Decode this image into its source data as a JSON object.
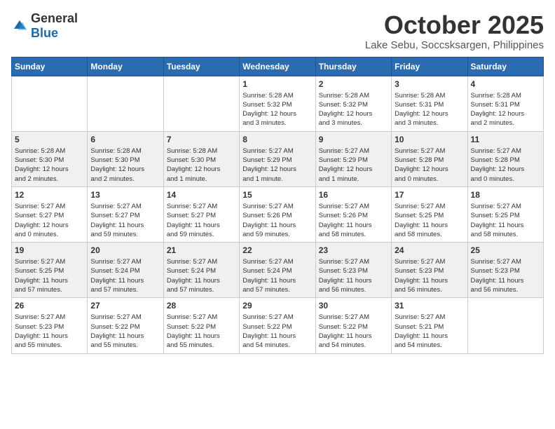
{
  "logo": {
    "general": "General",
    "blue": "Blue"
  },
  "title": "October 2025",
  "location": "Lake Sebu, Soccsksargen, Philippines",
  "weekdays": [
    "Sunday",
    "Monday",
    "Tuesday",
    "Wednesday",
    "Thursday",
    "Friday",
    "Saturday"
  ],
  "weeks": [
    [
      {
        "day": "",
        "info": ""
      },
      {
        "day": "",
        "info": ""
      },
      {
        "day": "",
        "info": ""
      },
      {
        "day": "1",
        "info": "Sunrise: 5:28 AM\nSunset: 5:32 PM\nDaylight: 12 hours\nand 3 minutes."
      },
      {
        "day": "2",
        "info": "Sunrise: 5:28 AM\nSunset: 5:32 PM\nDaylight: 12 hours\nand 3 minutes."
      },
      {
        "day": "3",
        "info": "Sunrise: 5:28 AM\nSunset: 5:31 PM\nDaylight: 12 hours\nand 3 minutes."
      },
      {
        "day": "4",
        "info": "Sunrise: 5:28 AM\nSunset: 5:31 PM\nDaylight: 12 hours\nand 2 minutes."
      }
    ],
    [
      {
        "day": "5",
        "info": "Sunrise: 5:28 AM\nSunset: 5:30 PM\nDaylight: 12 hours\nand 2 minutes."
      },
      {
        "day": "6",
        "info": "Sunrise: 5:28 AM\nSunset: 5:30 PM\nDaylight: 12 hours\nand 2 minutes."
      },
      {
        "day": "7",
        "info": "Sunrise: 5:28 AM\nSunset: 5:30 PM\nDaylight: 12 hours\nand 1 minute."
      },
      {
        "day": "8",
        "info": "Sunrise: 5:27 AM\nSunset: 5:29 PM\nDaylight: 12 hours\nand 1 minute."
      },
      {
        "day": "9",
        "info": "Sunrise: 5:27 AM\nSunset: 5:29 PM\nDaylight: 12 hours\nand 1 minute."
      },
      {
        "day": "10",
        "info": "Sunrise: 5:27 AM\nSunset: 5:28 PM\nDaylight: 12 hours\nand 0 minutes."
      },
      {
        "day": "11",
        "info": "Sunrise: 5:27 AM\nSunset: 5:28 PM\nDaylight: 12 hours\nand 0 minutes."
      }
    ],
    [
      {
        "day": "12",
        "info": "Sunrise: 5:27 AM\nSunset: 5:27 PM\nDaylight: 12 hours\nand 0 minutes."
      },
      {
        "day": "13",
        "info": "Sunrise: 5:27 AM\nSunset: 5:27 PM\nDaylight: 11 hours\nand 59 minutes."
      },
      {
        "day": "14",
        "info": "Sunrise: 5:27 AM\nSunset: 5:27 PM\nDaylight: 11 hours\nand 59 minutes."
      },
      {
        "day": "15",
        "info": "Sunrise: 5:27 AM\nSunset: 5:26 PM\nDaylight: 11 hours\nand 59 minutes."
      },
      {
        "day": "16",
        "info": "Sunrise: 5:27 AM\nSunset: 5:26 PM\nDaylight: 11 hours\nand 58 minutes."
      },
      {
        "day": "17",
        "info": "Sunrise: 5:27 AM\nSunset: 5:25 PM\nDaylight: 11 hours\nand 58 minutes."
      },
      {
        "day": "18",
        "info": "Sunrise: 5:27 AM\nSunset: 5:25 PM\nDaylight: 11 hours\nand 58 minutes."
      }
    ],
    [
      {
        "day": "19",
        "info": "Sunrise: 5:27 AM\nSunset: 5:25 PM\nDaylight: 11 hours\nand 57 minutes."
      },
      {
        "day": "20",
        "info": "Sunrise: 5:27 AM\nSunset: 5:24 PM\nDaylight: 11 hours\nand 57 minutes."
      },
      {
        "day": "21",
        "info": "Sunrise: 5:27 AM\nSunset: 5:24 PM\nDaylight: 11 hours\nand 57 minutes."
      },
      {
        "day": "22",
        "info": "Sunrise: 5:27 AM\nSunset: 5:24 PM\nDaylight: 11 hours\nand 57 minutes."
      },
      {
        "day": "23",
        "info": "Sunrise: 5:27 AM\nSunset: 5:23 PM\nDaylight: 11 hours\nand 56 minutes."
      },
      {
        "day": "24",
        "info": "Sunrise: 5:27 AM\nSunset: 5:23 PM\nDaylight: 11 hours\nand 56 minutes."
      },
      {
        "day": "25",
        "info": "Sunrise: 5:27 AM\nSunset: 5:23 PM\nDaylight: 11 hours\nand 56 minutes."
      }
    ],
    [
      {
        "day": "26",
        "info": "Sunrise: 5:27 AM\nSunset: 5:23 PM\nDaylight: 11 hours\nand 55 minutes."
      },
      {
        "day": "27",
        "info": "Sunrise: 5:27 AM\nSunset: 5:22 PM\nDaylight: 11 hours\nand 55 minutes."
      },
      {
        "day": "28",
        "info": "Sunrise: 5:27 AM\nSunset: 5:22 PM\nDaylight: 11 hours\nand 55 minutes."
      },
      {
        "day": "29",
        "info": "Sunrise: 5:27 AM\nSunset: 5:22 PM\nDaylight: 11 hours\nand 54 minutes."
      },
      {
        "day": "30",
        "info": "Sunrise: 5:27 AM\nSunset: 5:22 PM\nDaylight: 11 hours\nand 54 minutes."
      },
      {
        "day": "31",
        "info": "Sunrise: 5:27 AM\nSunset: 5:21 PM\nDaylight: 11 hours\nand 54 minutes."
      },
      {
        "day": "",
        "info": ""
      }
    ]
  ],
  "row_shading": [
    false,
    true,
    false,
    true,
    false
  ]
}
